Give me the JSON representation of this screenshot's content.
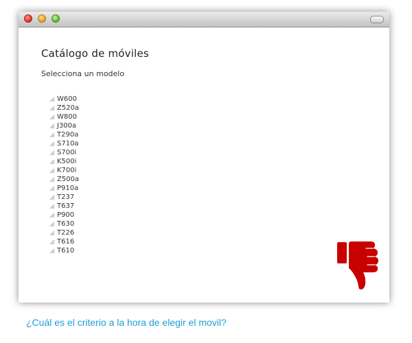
{
  "window": {
    "controls": [
      "close",
      "minimize",
      "zoom"
    ]
  },
  "page": {
    "title": "Catálogo de móviles",
    "subtitle": "Selecciona un modelo"
  },
  "models": [
    "W600",
    "Z520a",
    "W800",
    "J300a",
    "T290a",
    "S710a",
    "S700i",
    "K500i",
    "K700i",
    "Z500a",
    "P910a",
    "T237",
    "T637",
    "P900",
    "T630",
    "T226",
    "T616",
    "T610"
  ],
  "icons": {
    "list_item": "grip-icon",
    "feedback": "thumbs-down-icon"
  },
  "colors": {
    "thumb": "#c90000",
    "question": "#1a9fd6"
  },
  "question": "¿Cuál es el criterio a la hora de elegir el movil?"
}
